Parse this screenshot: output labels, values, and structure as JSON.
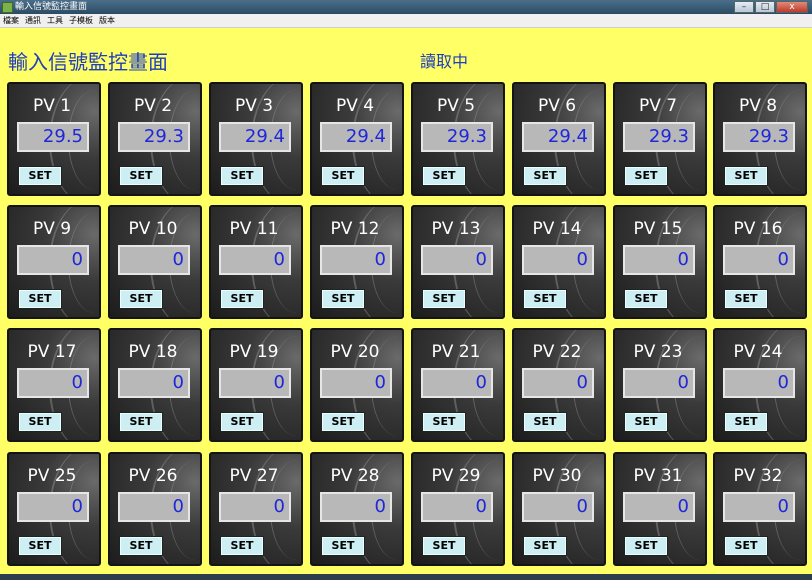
{
  "window": {
    "title": "輸入信號監控畫面"
  },
  "menu": [
    "檔案",
    "通訊",
    "工具",
    "子模板",
    "版本"
  ],
  "page": {
    "title": "輸入信號監控畫面",
    "status": "讀取中"
  },
  "window_buttons": {
    "minimize": "–",
    "maximize": "□",
    "close": "x"
  },
  "set_label": "SET",
  "panels": [
    {
      "label": "PV 1",
      "value": "29.5"
    },
    {
      "label": "PV 2",
      "value": "29.3"
    },
    {
      "label": "PV 3",
      "value": "29.4"
    },
    {
      "label": "PV 4",
      "value": "29.4"
    },
    {
      "label": "PV 5",
      "value": "29.3"
    },
    {
      "label": "PV 6",
      "value": "29.4"
    },
    {
      "label": "PV 7",
      "value": "29.3"
    },
    {
      "label": "PV 8",
      "value": "29.3"
    },
    {
      "label": "PV 9",
      "value": "0"
    },
    {
      "label": "PV 10",
      "value": "0"
    },
    {
      "label": "PV 11",
      "value": "0"
    },
    {
      "label": "PV 12",
      "value": "0"
    },
    {
      "label": "PV 13",
      "value": "0"
    },
    {
      "label": "PV 14",
      "value": "0"
    },
    {
      "label": "PV 15",
      "value": "0"
    },
    {
      "label": "PV 16",
      "value": "0"
    },
    {
      "label": "PV 17",
      "value": "0"
    },
    {
      "label": "PV 18",
      "value": "0"
    },
    {
      "label": "PV 19",
      "value": "0"
    },
    {
      "label": "PV 20",
      "value": "0"
    },
    {
      "label": "PV 21",
      "value": "0"
    },
    {
      "label": "PV 22",
      "value": "0"
    },
    {
      "label": "PV 23",
      "value": "0"
    },
    {
      "label": "PV 24",
      "value": "0"
    },
    {
      "label": "PV 25",
      "value": "0"
    },
    {
      "label": "PV 26",
      "value": "0"
    },
    {
      "label": "PV 27",
      "value": "0"
    },
    {
      "label": "PV 28",
      "value": "0"
    },
    {
      "label": "PV 29",
      "value": "0"
    },
    {
      "label": "PV 30",
      "value": "0"
    },
    {
      "label": "PV 31",
      "value": "0"
    },
    {
      "label": "PV 32",
      "value": "0"
    }
  ]
}
